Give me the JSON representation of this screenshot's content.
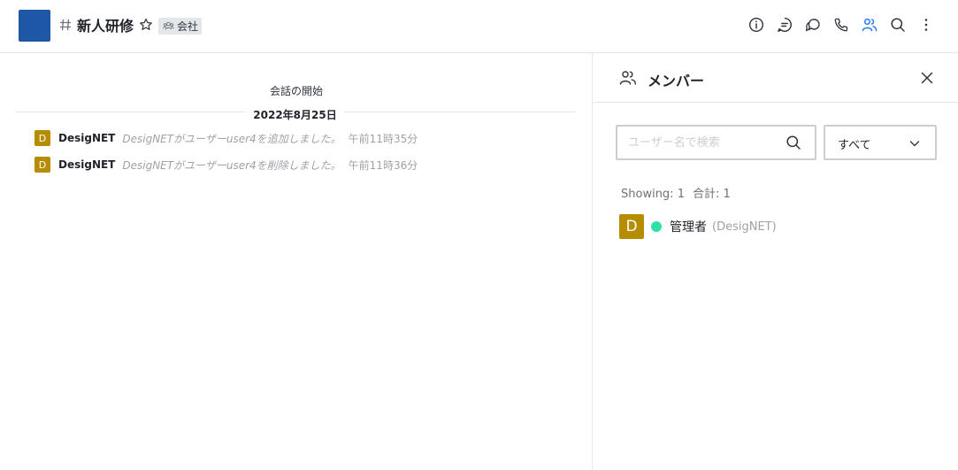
{
  "header": {
    "room_name": "新人研修",
    "team_badge": "会社",
    "icons": [
      "info-icon",
      "threads-icon",
      "discussion-icon",
      "call-icon",
      "members-icon",
      "search-icon",
      "kebab-menu-icon"
    ],
    "accent": "#1d57a6"
  },
  "main": {
    "conversation_start": "会話の開始",
    "date": "2022年8月25日",
    "messages": [
      {
        "avatar_letter": "D",
        "user": "DesigNET",
        "text": "DesigNETがユーザーuser4を追加しました。",
        "time": "午前11時35分"
      },
      {
        "avatar_letter": "D",
        "user": "DesigNET",
        "text": "DesigNETがユーザーuser4を削除しました。",
        "time": "午前11時36分"
      }
    ]
  },
  "panel": {
    "title": "メンバー",
    "search_placeholder": "ユーザー名で検索",
    "filter_value": "すべて",
    "showing": "Showing: 1",
    "total": "合計: 1",
    "members": [
      {
        "avatar_letter": "D",
        "name": "管理者",
        "username": "(DesigNET)",
        "status": "online",
        "status_color": "#2de0a5"
      }
    ]
  }
}
